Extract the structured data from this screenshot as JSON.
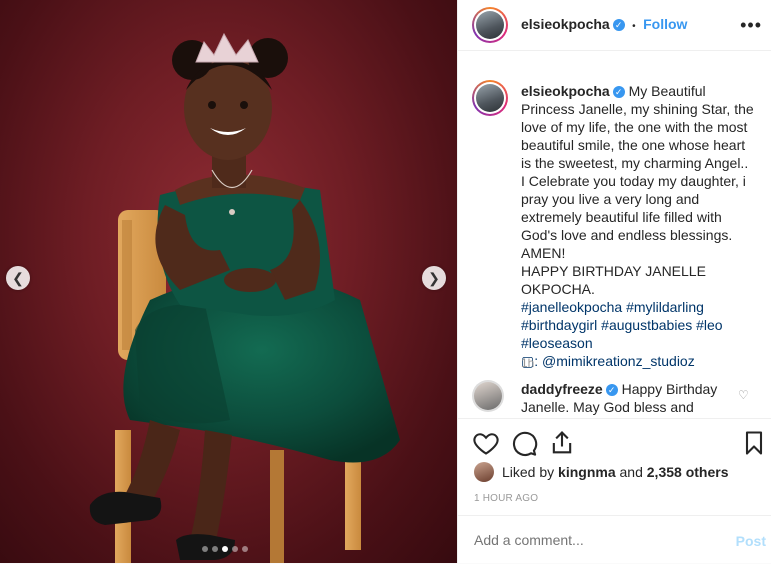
{
  "post": {
    "username": "elsieokpocha",
    "follow_label": "Follow",
    "separator": "•",
    "more_label": "•••",
    "caption": {
      "username": "elsieokpocha",
      "text": "My Beautiful Princess Janelle, my shining Star, the love of my life, the one with the most beautiful smile, the one whose heart is the sweetest, my charming Angel..\nI Celebrate you today my daughter, i pray you live a very long and extremely beautiful life filled with God's love and endless blessings. AMEN!\nHAPPY BIRTHDAY JANELLE OKPOCHA.",
      "hashtags": "#janelleokpocha #mylildarling #birthdaygirl #augustbabies #leo #leoseason",
      "credit": "▢: @mimikreationz_studioz",
      "time": "1h"
    },
    "comment": {
      "username": "daddyfreeze",
      "text": "Happy Birthday Janelle. May God bless and"
    },
    "likes": {
      "prefix": "Liked by",
      "user": "kingnma",
      "joiner": "and",
      "others": "2,358 others"
    },
    "timestamp": "1 HOUR AGO",
    "comment_placeholder": "Add a comment...",
    "post_label": "Post",
    "carousel": {
      "slides": 5,
      "active": 3
    }
  },
  "colors": {
    "accent": "#3897f0",
    "hashtag": "#003569",
    "backdrop": "#6e1d24",
    "dress": "#0f4a3a"
  }
}
